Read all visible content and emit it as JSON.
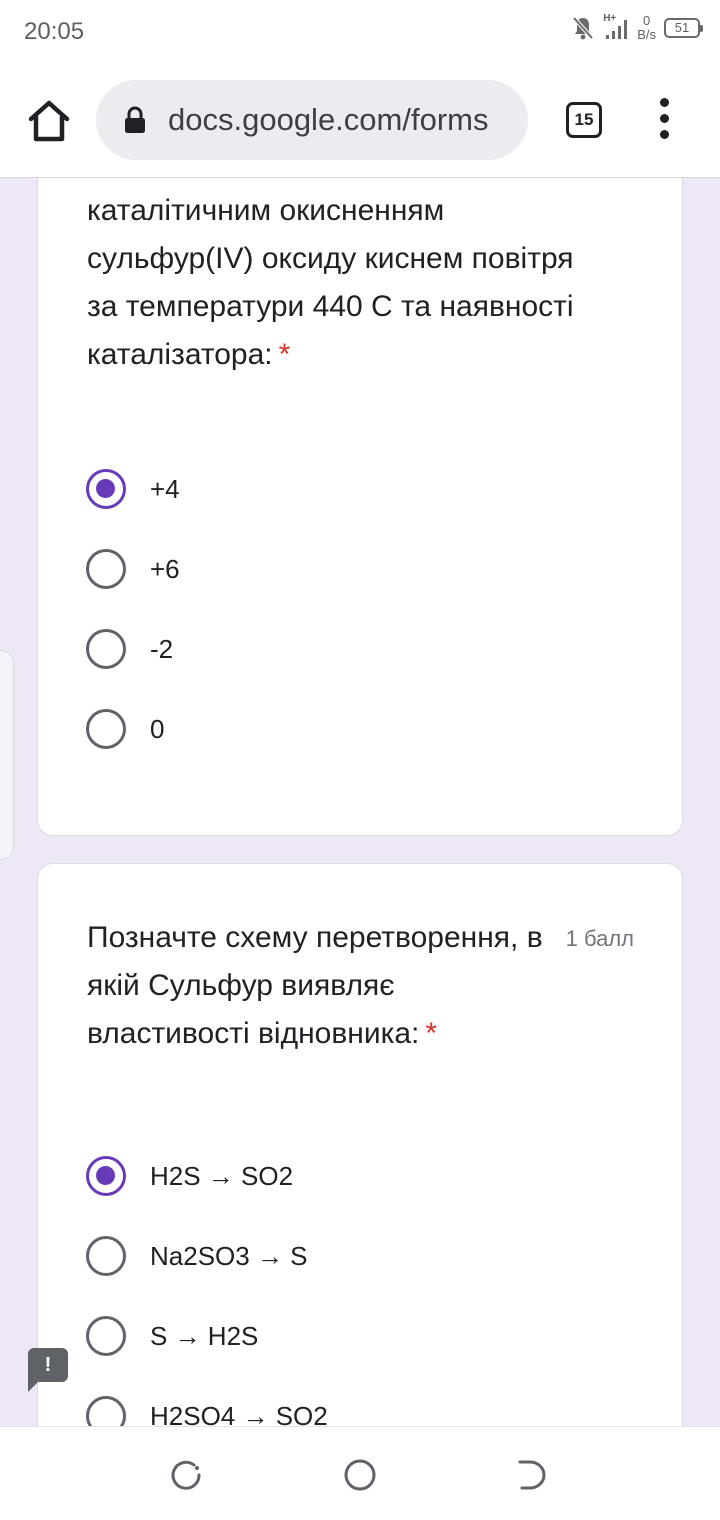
{
  "status_bar": {
    "time": "20:05",
    "signal_label": "H+",
    "net_speed_value": "0",
    "net_speed_unit": "B/s",
    "battery": "51"
  },
  "browser": {
    "url": "docs.google.com/forms",
    "tab_count": "15"
  },
  "question1": {
    "text": "Сульфуру в сполуці, яку добувають каталітичним окисненням сульфур(IV) оксиду киснем повітря за температури 440 С та наявності каталізатора:",
    "required_mark": "*",
    "options": [
      {
        "label": "+4",
        "selected": true
      },
      {
        "label": "+6",
        "selected": false
      },
      {
        "label": "-2",
        "selected": false
      },
      {
        "label": "0",
        "selected": false
      }
    ]
  },
  "question2": {
    "text": "Позначте схему перетворення, в якій Сульфур виявляє властивості відновника:",
    "required_mark": "*",
    "points": "1 балл",
    "options": [
      {
        "label": "H2S → SO2",
        "selected": true
      },
      {
        "label": "Na2SO3 → S",
        "selected": false
      },
      {
        "label": "S → H2S",
        "selected": false
      },
      {
        "label": "H2SO4 → SO2",
        "selected": false
      }
    ]
  },
  "feedback_button": {
    "label": "!"
  },
  "colors": {
    "accent": "#673ab7",
    "required": "#d93025",
    "page_background": "#ede7f6"
  }
}
